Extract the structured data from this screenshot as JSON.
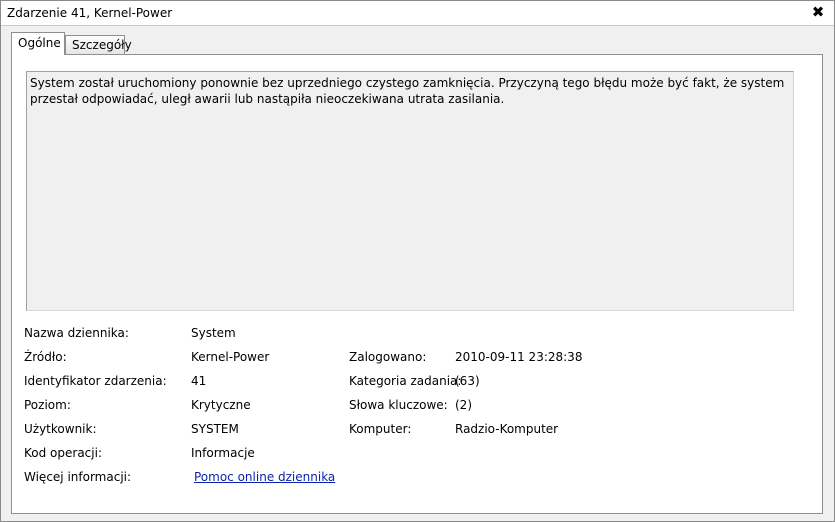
{
  "window": {
    "title": "Zdarzenie 41, Kernel-Power",
    "close_glyph": "✖"
  },
  "tabs": [
    {
      "label": "Ogólne"
    },
    {
      "label": "Szczegóły"
    }
  ],
  "description": "System został uruchomiony ponownie bez uprzedniego czystego zamknięcia. Przyczyną tego błędu może być fakt, że system przestał odpowiadać, uległ awarii lub nastąpiła nieoczekiwana utrata zasilania.",
  "fields": {
    "log_name": {
      "label": "Nazwa dziennika:",
      "value": "System"
    },
    "source": {
      "label": "Źródło:",
      "value": "Kernel-Power"
    },
    "logged": {
      "label": "Zalogowano:",
      "value": "2010-09-11 23:28:38"
    },
    "event_id": {
      "label": "Identyfikator zdarzenia:",
      "value": "41"
    },
    "task_category": {
      "label": "Kategoria zadania:",
      "value": "(63)"
    },
    "level": {
      "label": "Poziom:",
      "value": "Krytyczne"
    },
    "keywords": {
      "label": "Słowa kluczowe:",
      "value": "(2)"
    },
    "user": {
      "label": "Użytkownik:",
      "value": "SYSTEM"
    },
    "computer": {
      "label": "Komputer:",
      "value": "Radzio-Komputer"
    },
    "opcode": {
      "label": "Kod operacji:",
      "value": "Informacje"
    },
    "more_info": {
      "label": "Więcej informacji:",
      "link": "Pomoc online dziennika"
    }
  },
  "colors": {
    "link": "#0b24b0",
    "background": "#f0f0f0"
  }
}
